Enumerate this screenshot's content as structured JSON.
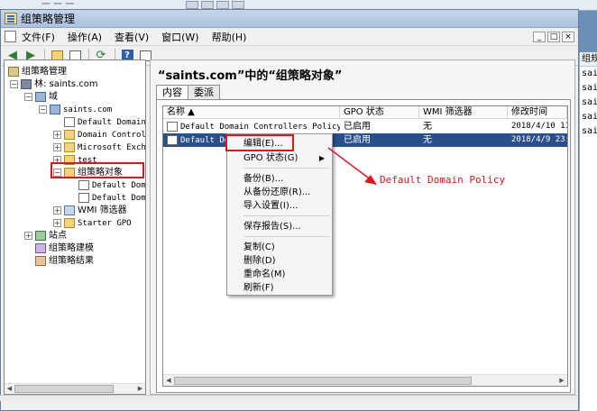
{
  "background_window": {
    "ghost_text": "一 一 一"
  },
  "right_pane": {
    "header": "组规",
    "items": [
      "sai",
      "sai",
      "sai",
      "sai",
      "sai"
    ]
  },
  "window": {
    "title": "组策略管理"
  },
  "menu": {
    "items": [
      "文件(F)",
      "操作(A)",
      "查看(V)",
      "窗口(W)",
      "帮助(H)"
    ]
  },
  "tree": {
    "root": "组策略管理",
    "forest": "林: saints.com",
    "domains": "域",
    "domain": "saints.com",
    "children": [
      "Default Domain",
      "Domain Control",
      "Microsoft Exch",
      "test"
    ],
    "gpo_container": "组策略对象",
    "gpos": [
      "Default Dom",
      "Default Dom"
    ],
    "wmi": "WMI 筛选器",
    "starter": "Starter GPO",
    "sites": "站点",
    "modeling": "组策略建模",
    "results": "组策略结果"
  },
  "content": {
    "title": "“saints.com”中的“组策略对象”",
    "tabs": [
      "内容",
      "委派"
    ],
    "columns": [
      "名称 ▲",
      "GPO 状态",
      "WMI 筛选器",
      "修改时间"
    ],
    "rows": [
      {
        "name": "Default Domain Controllers Policy",
        "status": "已启用",
        "wmi": "无",
        "modified": "2018/4/10 11."
      },
      {
        "name": "Default Domain Poli",
        "status": "已启用",
        "wmi": "无",
        "modified": "2018/4/9 23:"
      }
    ]
  },
  "context_menu": {
    "items": [
      "编辑(E)...",
      "GPO 状态(G)",
      "备份(B)...",
      "从备份还原(R)...",
      "导入设置(I)...",
      "保存报告(S)...",
      "复制(C)",
      "删除(D)",
      "重命名(M)",
      "刷新(F)"
    ]
  },
  "annotation": {
    "text": "Default Domain Policy",
    "color": "#e0141e"
  },
  "colors": {
    "selection": "#2b4f8a",
    "highlight_box": "#e0141e"
  }
}
